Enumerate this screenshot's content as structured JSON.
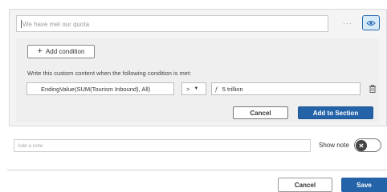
{
  "editor": {
    "text_value": "We have met our quota",
    "more_label": "···"
  },
  "condition": {
    "add_condition_label": "Add condition",
    "instruction": "Write this custom content when the following condition is met:",
    "field": "EndingValue(SUM(Tourism Inbound), All)",
    "operator": ">",
    "value": "5 trillion",
    "fx_symbol": "f",
    "cancel_label": "Cancel",
    "add_label": "Add to Section"
  },
  "note": {
    "placeholder": "Add a note",
    "show_note_label": "Show note"
  },
  "footer": {
    "cancel_label": "Cancel",
    "save_label": "Save"
  },
  "colors": {
    "accent": "#2563a8",
    "eye_bg": "#d6eaf8"
  },
  "icons": [
    "eye-icon",
    "plus-icon",
    "trash-icon",
    "chevron-down-icon",
    "function-icon",
    "close-icon"
  ]
}
